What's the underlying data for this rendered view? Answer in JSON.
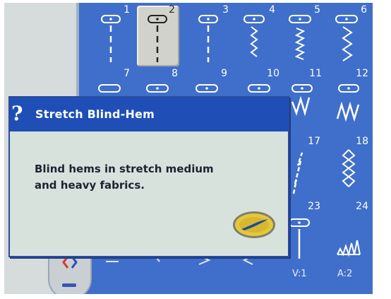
{
  "dialog": {
    "title": "Stretch Blind-Hem",
    "body_lines": [
      "Blind hems in stretch medium",
      "and heavy fabrics."
    ],
    "help_icon": "?",
    "ok_button_icon": "confirm-swoosh-icon"
  },
  "stitches": [
    {
      "number": "1"
    },
    {
      "number": "2",
      "selected": true
    },
    {
      "number": "3"
    },
    {
      "number": "4"
    },
    {
      "number": "5"
    },
    {
      "number": "6"
    },
    {
      "number": "7"
    },
    {
      "number": "8"
    },
    {
      "number": "9"
    },
    {
      "number": "10"
    },
    {
      "number": "11"
    },
    {
      "number": "12"
    },
    {
      "number": "17"
    },
    {
      "number": "18"
    },
    {
      "number": "23"
    },
    {
      "number": "24"
    }
  ],
  "footer_labels": {
    "v": "V:1",
    "a": "A:2"
  },
  "colors": {
    "screen": "#3f6fca",
    "dialog_header": "#1f4fb6",
    "dialog_body": "#d8e2dd",
    "ok_button": "#e5c73c"
  }
}
